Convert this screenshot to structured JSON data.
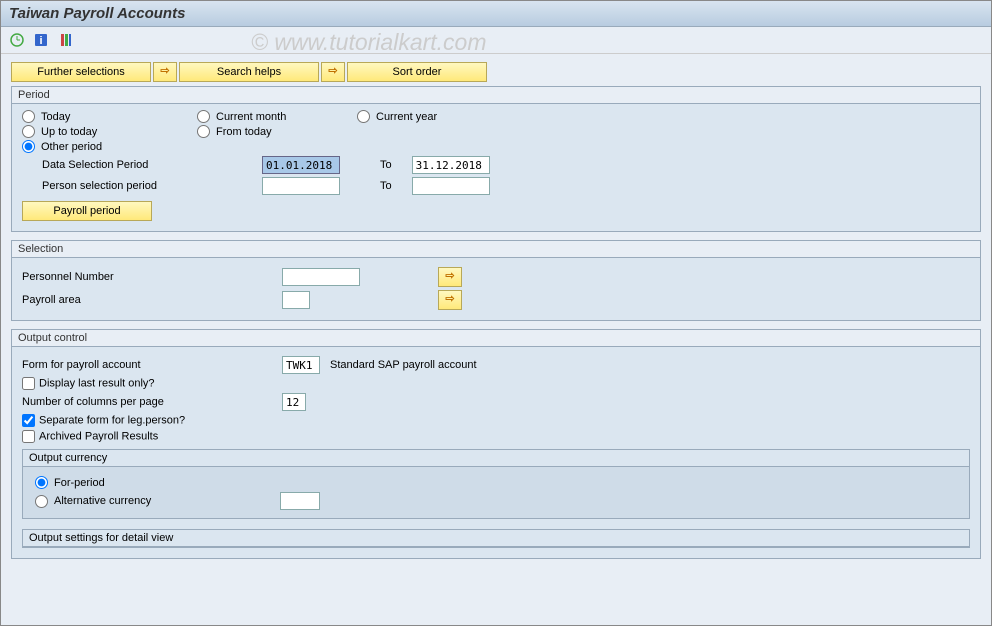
{
  "title": "Taiwan Payroll Accounts",
  "watermark": "© www.tutorialkart.com",
  "toolbar": {
    "further_selections": "Further selections",
    "search_helps": "Search helps",
    "sort_order": "Sort order"
  },
  "period": {
    "title": "Period",
    "today": "Today",
    "current_month": "Current month",
    "current_year": "Current year",
    "up_to_today": "Up to today",
    "from_today": "From today",
    "other_period": "Other period",
    "data_selection_period": "Data Selection Period",
    "data_sel_from": "01.01.2018",
    "data_sel_to": "31.12.2018",
    "to": "To",
    "person_selection_period": "Person selection period",
    "person_sel_from": "",
    "person_sel_to": "",
    "payroll_period": "Payroll period"
  },
  "selection": {
    "title": "Selection",
    "personnel_number": "Personnel Number",
    "payroll_area": "Payroll area"
  },
  "output_control": {
    "title": "Output control",
    "form_for_payroll_account": "Form for payroll account",
    "form_value": "TWK1",
    "form_desc": "Standard SAP payroll account",
    "display_last_result": "Display last result only?",
    "num_cols": "Number of columns per page",
    "num_cols_value": "12",
    "separate_form": "Separate form for leg.person?",
    "archived": "Archived Payroll Results",
    "output_currency": {
      "title": "Output currency",
      "for_period": "For-period",
      "alt_currency": "Alternative currency"
    },
    "output_settings_detail": "Output settings for detail view"
  }
}
